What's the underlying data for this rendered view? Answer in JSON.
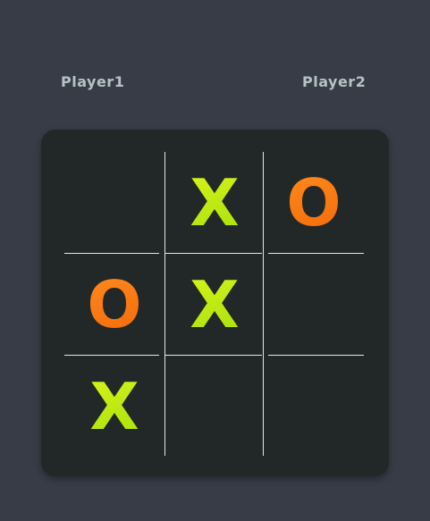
{
  "players": {
    "player1": "Player1",
    "player2": "Player2"
  },
  "board": {
    "cells": [
      {
        "id": 0,
        "value": ""
      },
      {
        "id": 1,
        "value": "X"
      },
      {
        "id": 2,
        "value": "O"
      },
      {
        "id": 3,
        "value": "O"
      },
      {
        "id": 4,
        "value": "X"
      },
      {
        "id": 5,
        "value": ""
      },
      {
        "id": 6,
        "value": "X"
      },
      {
        "id": 7,
        "value": ""
      },
      {
        "id": 8,
        "value": ""
      }
    ]
  },
  "colors": {
    "background": "#383c46",
    "board": "#222828",
    "player_label": "#b4c3c6",
    "x_mark": "#c8ec12",
    "o_mark": "#f97c12",
    "grid_line": "#e6e6e6"
  }
}
